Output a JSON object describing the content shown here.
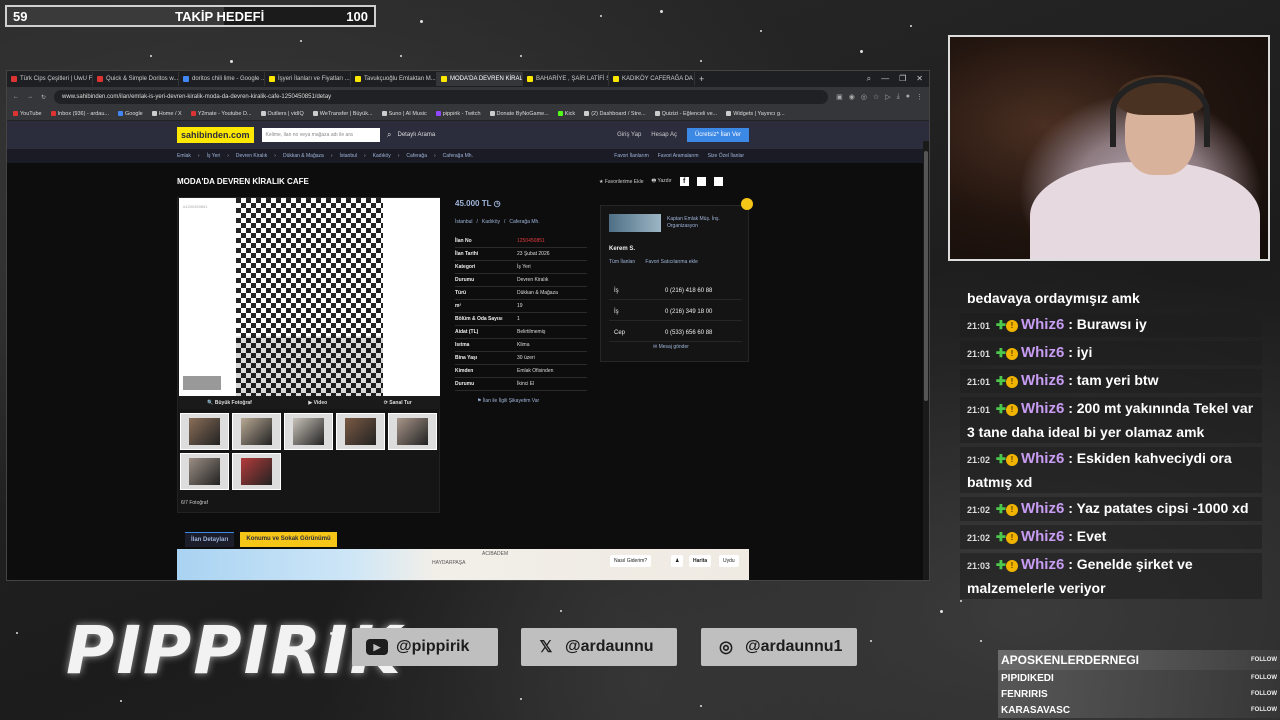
{
  "follower_goal": {
    "current": "59",
    "title": "TAKİP HEDEFİ",
    "max": "100",
    "progress": 0.59
  },
  "browser": {
    "tabs": [
      {
        "label": "Türk Cips Çeşitleri | UwU F...",
        "color": "#d33"
      },
      {
        "label": "Quick & Simple Doritos w...",
        "color": "#d33"
      },
      {
        "label": "doritos chili lime - Google ...",
        "color": "#4285f4"
      },
      {
        "label": "İşyeri İlanları ve Fiyatları ...",
        "color": "#ffe800"
      },
      {
        "label": "Tavukçuoğlu Emlaktan M...",
        "color": "#ffe800"
      },
      {
        "label": "MODA'DA DEVREN KİRAL...",
        "color": "#ffe800"
      },
      {
        "label": "BAHARİYE , ŞAİR LATİFİ S...",
        "color": "#ffe800"
      },
      {
        "label": "KADIKÖY CAFERAĞA DA ...",
        "color": "#ffe800"
      }
    ],
    "active_tab": 5,
    "new_tab": "+",
    "url": "www.sahibinden.com/ilan/emlak-is-yeri-devren-kiralik-moda-da-devren-kiralik-cafe-1250450851/detay",
    "bookmarks": [
      {
        "label": "YouTube",
        "color": "#d33"
      },
      {
        "label": "Inbox (936) - ardau...",
        "color": "#d33"
      },
      {
        "label": "Google",
        "color": "#4285f4"
      },
      {
        "label": "Home / X",
        "color": "#ccc"
      },
      {
        "label": "Y2mate - Youtube D...",
        "color": "#d33"
      },
      {
        "label": "Outliers | vidIQ",
        "color": "#ccc"
      },
      {
        "label": "WeTransfer | Büyük...",
        "color": "#ccc"
      },
      {
        "label": "Suno | AI Music",
        "color": "#ccc"
      },
      {
        "label": "pippirik - Twitch",
        "color": "#9146ff"
      },
      {
        "label": "Donate ByNoGame...",
        "color": "#ccc"
      },
      {
        "label": "Kick",
        "color": "#53fc18"
      },
      {
        "label": "(2) Dashboard / Stre...",
        "color": "#ccc"
      },
      {
        "label": "Quizizi - Eğlenceli ve...",
        "color": "#ccc"
      },
      {
        "label": "Widgets | Yayıncı g...",
        "color": "#ccc"
      }
    ]
  },
  "site": {
    "logo": "sahibinden.com",
    "search_placeholder": "Kelime, ilan no veya mağaza adı ile ara",
    "detailed_search": "Detaylı Arama",
    "login": "Giriş Yap",
    "register": "Hesap Aç",
    "post_ad": "Ücretsiz* İlan Ver",
    "breadcrumbs": [
      "Emlak",
      "İş Yeri",
      "Devren Kiralık",
      "Dükkan & Mağaza",
      "İstanbul",
      "Kadıköy",
      "Caferağa",
      "Caferağa Mh."
    ],
    "crumb_links": [
      "Favori İlanlarım",
      "Favori Aramalarım",
      "Size Özel İlanlar"
    ],
    "title": "MODA'DA DEVREN KİRALIK CAFE",
    "add_favorite": "Favorilerime Ekle",
    "print": "Yazdır",
    "photo_id": "#1250450851",
    "photo_tabs": [
      "Büyük Fotoğraf",
      "Video",
      "Sanal Tur"
    ],
    "photo_count": "6/7 Fotoğraf",
    "price": "45.000 TL",
    "location": [
      "İstanbul",
      "/",
      "Kadıköy",
      "/",
      "Caferağa Mh."
    ],
    "details": [
      {
        "k": "İlan No",
        "v": "1250450851",
        "red": true
      },
      {
        "k": "İlan Tarihi",
        "v": "23 Şubat 2026"
      },
      {
        "k": "Kategori",
        "v": "İş Yeri"
      },
      {
        "k": "Durumu",
        "v": "Devren Kiralık"
      },
      {
        "k": "Türü",
        "v": "Dükkan & Mağaza"
      },
      {
        "k": "m²",
        "v": "19"
      },
      {
        "k": "Bölüm & Oda Sayısı",
        "v": "1"
      },
      {
        "k": "Aidat (TL)",
        "v": "Belirtilmemiş"
      },
      {
        "k": "Isıtma",
        "v": "Klima"
      },
      {
        "k": "Bina Yaşı",
        "v": "30 üzeri"
      },
      {
        "k": "Kimden",
        "v": "Emlak Ofisinden"
      },
      {
        "k": "Durumu",
        "v": "İkinci El"
      }
    ],
    "complain": "İlan ile İlgili Şikayetim Var",
    "agency": "Kaptan Emlak Müş. İnş. Organizasyon",
    "seller_name": "Kerem S.",
    "seller_links": [
      "Tüm İlanları",
      "Favori Satıcılarıma ekle"
    ],
    "phones": [
      {
        "k": "İş",
        "v": "0 (216) 418 60 88"
      },
      {
        "k": "İş",
        "v": "0 (216) 349 18 00"
      },
      {
        "k": "Cep",
        "v": "0 (533) 656 60 88"
      }
    ],
    "send_message": "Mesaj gönder",
    "bottom_tabs": [
      "İlan Detayları",
      "Konumu ve Sokak Görünümü"
    ],
    "map_labels": [
      "ACIBADEM",
      "HAYDARPAŞA"
    ],
    "map_controls": [
      "Nasıl Giderim?",
      "Harita",
      "Uydu"
    ]
  },
  "chat": {
    "first": "bedavaya ordaymışız amk",
    "messages": [
      {
        "time": "21:01",
        "user": "Whiz6",
        "text": ": Burawsı iy"
      },
      {
        "time": "21:01",
        "user": "Whiz6",
        "text": ": iyi"
      },
      {
        "time": "21:01",
        "user": "Whiz6",
        "text": ": tam yeri btw"
      },
      {
        "time": "21:01",
        "user": "Whiz6",
        "text": ": 200 mt yakınında Tekel var 3 tane daha ideal bi yer olamaz amk"
      },
      {
        "time": "21:02",
        "user": "Whiz6",
        "text": ": Eskiden kahveciydi ora batmış xd"
      },
      {
        "time": "21:02",
        "user": "Whiz6",
        "text": ": Yaz patates cipsi -1000 xd"
      },
      {
        "time": "21:02",
        "user": "Whiz6",
        "text": ": Evet"
      },
      {
        "time": "21:03",
        "user": "Whiz6",
        "text": ": Genelde şirket ve malzemelerle veriyor"
      }
    ]
  },
  "brand": "PIPPIRIK",
  "socials": [
    {
      "icon": "youtube-icon",
      "handle": "@pippirik"
    },
    {
      "icon": "x-icon",
      "handle": "@ardaunnu"
    },
    {
      "icon": "instagram-icon",
      "handle": "@ardaunnu1"
    }
  ],
  "follows": {
    "label": "FOLLOW",
    "names": [
      "APOSKENLERDERNEGI",
      "PIPIDIKEDI",
      "FENRIRIS",
      "KARASAVASC"
    ]
  }
}
